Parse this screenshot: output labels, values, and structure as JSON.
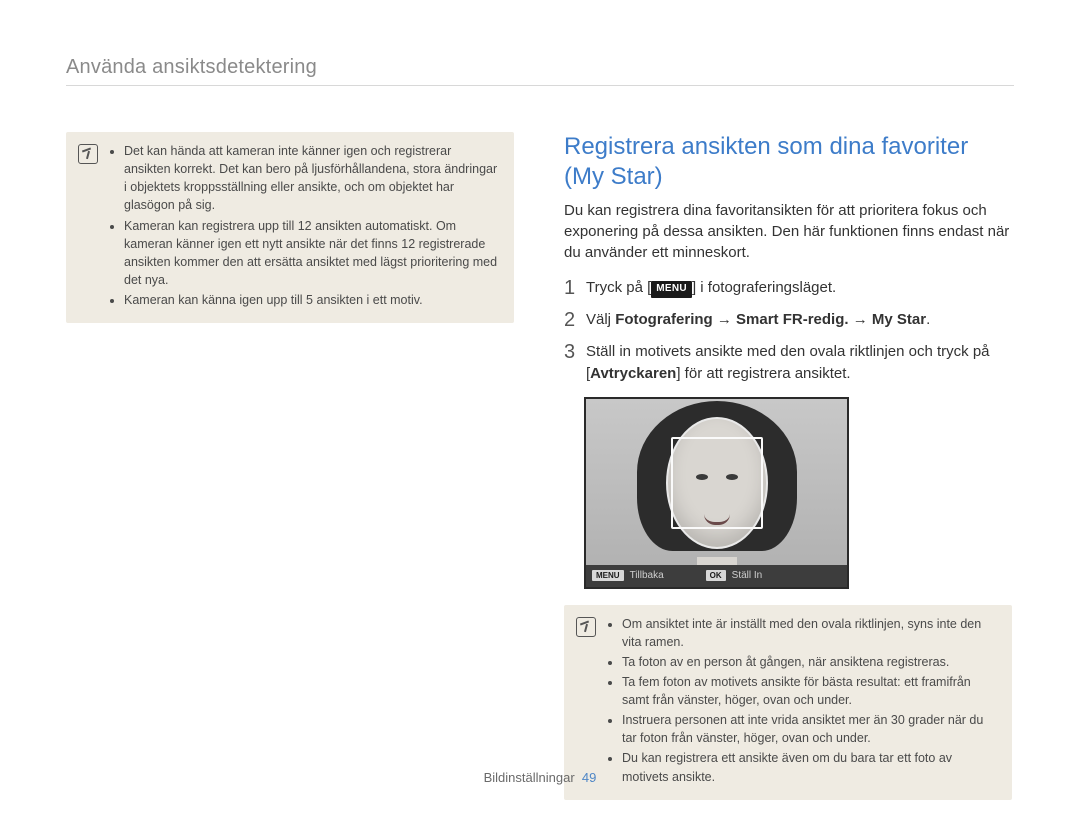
{
  "header": "Använda ansiktsdetektering",
  "left_note": {
    "items": [
      "Det kan hända att kameran inte känner igen och registrerar ansikten korrekt. Det kan bero på ljusförhållandena, stora ändringar i objektets kroppsställning eller ansikte, och om objektet har glasögon på sig.",
      "Kameran kan registrera upp till 12 ansikten automatiskt. Om kameran känner igen ett nytt ansikte när det finns 12 registrerade ansikten kommer den att ersätta ansiktet med lägst prioritering med det nya.",
      "Kameran kan känna igen upp till 5 ansikten i ett motiv."
    ]
  },
  "section": {
    "title": "Registrera ansikten som dina favoriter (My Star)",
    "intro": "Du kan registrera dina favoritansikten för att prioritera fokus och exponering på dessa ansikten. Den här funktionen finns endast när du använder ett minneskort."
  },
  "steps": {
    "s1_pre": "Tryck på [",
    "s1_chip": "MENU",
    "s1_post": "] i fotograferingsläget.",
    "s2_pre": "Välj ",
    "s2_b1": "Fotografering",
    "s2_arrow1": " → ",
    "s2_b2": "Smart FR-redig.",
    "s2_arrow2": " → ",
    "s2_b3": "My Star",
    "s2_end": ".",
    "s3_line1": "Ställ in motivets ansikte med den ovala riktlinjen och tryck på [",
    "s3_bold": "Avtryckaren",
    "s3_line2": "] för att registrera ansiktet."
  },
  "preview_bar": {
    "menu_chip": "MENU",
    "back": "Tillbaka",
    "ok_chip": "OK",
    "set": "Ställ In"
  },
  "right_note": {
    "items": [
      "Om ansiktet inte är inställt med den ovala riktlinjen, syns inte den vita ramen.",
      "Ta foton av en person åt gången, när ansiktena registreras.",
      "Ta fem foton av motivets ansikte för bästa resultat: ett framifrån samt från vänster, höger, ovan och under.",
      "Instruera personen att inte vrida ansiktet mer än 30 grader när du tar foton från vänster, höger, ovan och under.",
      "Du kan registrera ett ansikte även om du bara tar ett foto av motivets ansikte."
    ]
  },
  "footer": {
    "label": "Bildinställningar",
    "page": "49"
  }
}
